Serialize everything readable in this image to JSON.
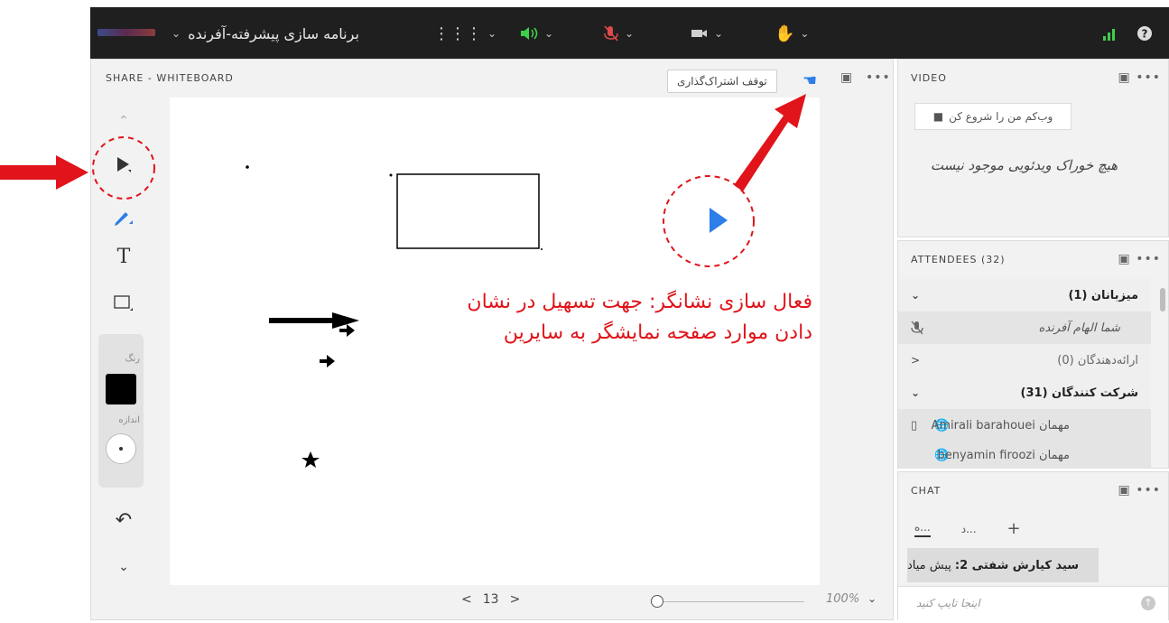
{
  "topbar": {
    "app_title": "برنامه سازی پیشرفته-آفرنده",
    "chevron": "⌄"
  },
  "share": {
    "title": "SHARE - WHITEBOARD",
    "stop_sharing_label": "توقف اشتراک‌گذاری",
    "page_number": "13",
    "zoom": "100%"
  },
  "toolbar": {
    "color_label": "رنگ",
    "size_label": "اندازه",
    "color": "#000000"
  },
  "video": {
    "title": "VIDEO",
    "webcam_button": "وب‌کم من را شروع کن",
    "empty_message": "هیچ خوراک ویدئویی موجود نیست"
  },
  "attendees": {
    "title": "ATTENDEES (32)",
    "groups": [
      {
        "label": "میزبانان (1)"
      },
      {
        "label": "ارائه‌دهندگان (0)"
      },
      {
        "label": "شرکت کنندگان (31)"
      }
    ],
    "host_name": "شما الهام آفرنده",
    "participant_1": "Amirali barahouei مهمان",
    "participant_2": "benyamin firoozi مهمان"
  },
  "chat": {
    "title": "CHAT",
    "tab_1": "ه...",
    "tab_2": "د...",
    "message_sender": "سید کیارش شفتی 2:",
    "message_text": "پیش میاد",
    "input_placeholder": "اینجا تایپ کنید"
  },
  "annotation": {
    "line_1": "فعال سازی نشانگر: جهت تسهیل در نشان",
    "line_2": "دادن موارد صفحه نمایشگر به سایرین",
    "color": "#e0141a"
  }
}
